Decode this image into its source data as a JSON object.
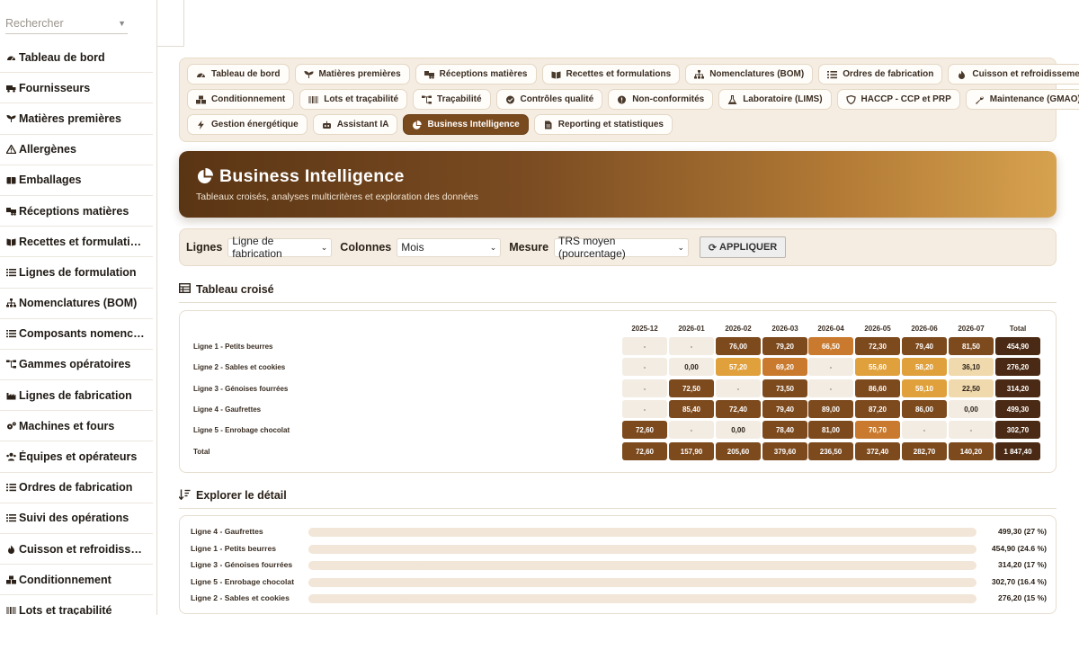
{
  "sidebar": {
    "search_placeholder": "Rechercher",
    "items": [
      {
        "label": "Tableau de bord",
        "icon": "gauge-icon"
      },
      {
        "label": "Fournisseurs",
        "icon": "truck-icon"
      },
      {
        "label": "Matières premières",
        "icon": "seedling-icon"
      },
      {
        "label": "Allergènes",
        "icon": "warning-icon"
      },
      {
        "label": "Emballages",
        "icon": "box-icon"
      },
      {
        "label": "Réceptions matières",
        "icon": "truck-loading-icon"
      },
      {
        "label": "Recettes et formulations",
        "icon": "book-icon"
      },
      {
        "label": "Lignes de formulation",
        "icon": "list-icon"
      },
      {
        "label": "Nomenclatures (BOM)",
        "icon": "sitemap-icon"
      },
      {
        "label": "Composants nomenclature",
        "icon": "list-icon"
      },
      {
        "label": "Gammes opératoires",
        "icon": "flow-icon"
      },
      {
        "label": "Lignes de fabrication",
        "icon": "industry-icon"
      },
      {
        "label": "Machines et fours",
        "icon": "cogs-icon"
      },
      {
        "label": "Équipes et opérateurs",
        "icon": "users-icon"
      },
      {
        "label": "Ordres de fabrication",
        "icon": "tasks-icon"
      },
      {
        "label": "Suivi des opérations",
        "icon": "list-icon"
      },
      {
        "label": "Cuisson et refroidissement",
        "icon": "flame-icon"
      },
      {
        "label": "Conditionnement",
        "icon": "boxes-icon"
      },
      {
        "label": "Lots et traçabilité",
        "icon": "barcode-icon"
      }
    ]
  },
  "modules": {
    "rows": [
      [
        {
          "label": "Tableau de bord",
          "icon": "gauge-icon"
        },
        {
          "label": "Matières premières",
          "icon": "seedling-icon"
        },
        {
          "label": "Réceptions matières",
          "icon": "truck-loading-icon"
        },
        {
          "label": "Recettes et formulations",
          "icon": "book-icon"
        },
        {
          "label": "Nomenclatures (BOM)",
          "icon": "sitemap-icon"
        },
        {
          "label": "Ordres de fabrication",
          "icon": "tasks-icon"
        },
        {
          "label": "Cuisson et refroidissement",
          "icon": "flame-icon"
        }
      ],
      [
        {
          "label": "Conditionnement",
          "icon": "boxes-icon"
        },
        {
          "label": "Lots et traçabilité",
          "icon": "barcode-icon"
        },
        {
          "label": "Traçabilité",
          "icon": "flow-icon"
        },
        {
          "label": "Contrôles qualité",
          "icon": "check-circle-icon"
        },
        {
          "label": "Non-conformités",
          "icon": "exclamation-circle-icon"
        },
        {
          "label": "Laboratoire (LIMS)",
          "icon": "flask-icon"
        },
        {
          "label": "HACCP - CCP et PRP",
          "icon": "shield-icon"
        },
        {
          "label": "Maintenance (GMAO)",
          "icon": "wrench-icon"
        }
      ],
      [
        {
          "label": "Gestion énergétique",
          "icon": "bolt-icon"
        },
        {
          "label": "Assistant IA",
          "icon": "robot-icon"
        },
        {
          "label": "Business Intelligence",
          "icon": "pie-chart-icon",
          "active": true
        },
        {
          "label": "Reporting et statistiques",
          "icon": "file-icon"
        }
      ]
    ]
  },
  "hero": {
    "title": "Business Intelligence",
    "subtitle": "Tableaux croisés, analyses multicritères et exploration des données"
  },
  "filters": {
    "rows_label": "Lignes",
    "rows_value": "Ligne de fabrication",
    "cols_label": "Colonnes",
    "cols_value": "Mois",
    "measure_label": "Mesure",
    "measure_value": "TRS moyen (pourcentage)",
    "apply_label": "APPLIQUER"
  },
  "pivot": {
    "title": "Tableau croisé",
    "columns": [
      "2025-12",
      "2026-01",
      "2026-02",
      "2026-03",
      "2026-04",
      "2026-05",
      "2026-06",
      "2026-07",
      "Total"
    ],
    "rows": [
      {
        "label": "Ligne 1 - Petits beurres",
        "values": [
          "-",
          "-",
          "76,00",
          "79,20",
          "66,50",
          "72,30",
          "79,40",
          "81,50",
          "454,90"
        ]
      },
      {
        "label": "Ligne 2 - Sables et cookies",
        "values": [
          "-",
          "0,00",
          "57,20",
          "69,20",
          "-",
          "55,60",
          "58,20",
          "36,10",
          "276,20"
        ]
      },
      {
        "label": "Ligne 3 - Génoises fourrées",
        "values": [
          "-",
          "72,50",
          "-",
          "73,50",
          "-",
          "86,60",
          "59,10",
          "22,50",
          "314,20"
        ]
      },
      {
        "label": "Ligne 4 - Gaufrettes",
        "values": [
          "-",
          "85,40",
          "72,40",
          "79,40",
          "89,00",
          "87,20",
          "86,00",
          "0,00",
          "499,30"
        ]
      },
      {
        "label": "Ligne 5 - Enrobage chocolat",
        "values": [
          "72,60",
          "-",
          "0,00",
          "78,40",
          "81,00",
          "70,70",
          "-",
          "-",
          "302,70"
        ]
      },
      {
        "label": "Total",
        "values": [
          "72,60",
          "157,90",
          "205,60",
          "379,60",
          "236,50",
          "372,40",
          "282,70",
          "140,20",
          "1 847,40"
        ]
      }
    ]
  },
  "explore": {
    "title": "Explorer le détail",
    "items": [
      {
        "label": "Ligne 4 - Gaufrettes",
        "value": "499,30 (27 %)",
        "share": 0.27
      },
      {
        "label": "Ligne 1 - Petits beurres",
        "value": "454,90 (24.6 %)",
        "share": 0.246
      },
      {
        "label": "Ligne 3 - Génoises fourrées",
        "value": "314,20 (17 %)",
        "share": 0.17
      },
      {
        "label": "Ligne 5 - Enrobage chocolat",
        "value": "302,70 (16.4 %)",
        "share": 0.164
      },
      {
        "label": "Ligne 2 - Sables et cookies",
        "value": "276,20 (15 %)",
        "share": 0.15
      }
    ]
  },
  "colors": {
    "brand_dark": "#5a3514",
    "brand_light": "#d7a24f",
    "cell_empty": "#f3ece3",
    "cell_low": "#f0d9ad",
    "cell_mid": "#e0a13d",
    "cell_high": "#c97a2e",
    "cell_top": "#7d4a1e",
    "cell_total": "#4a2a14"
  }
}
